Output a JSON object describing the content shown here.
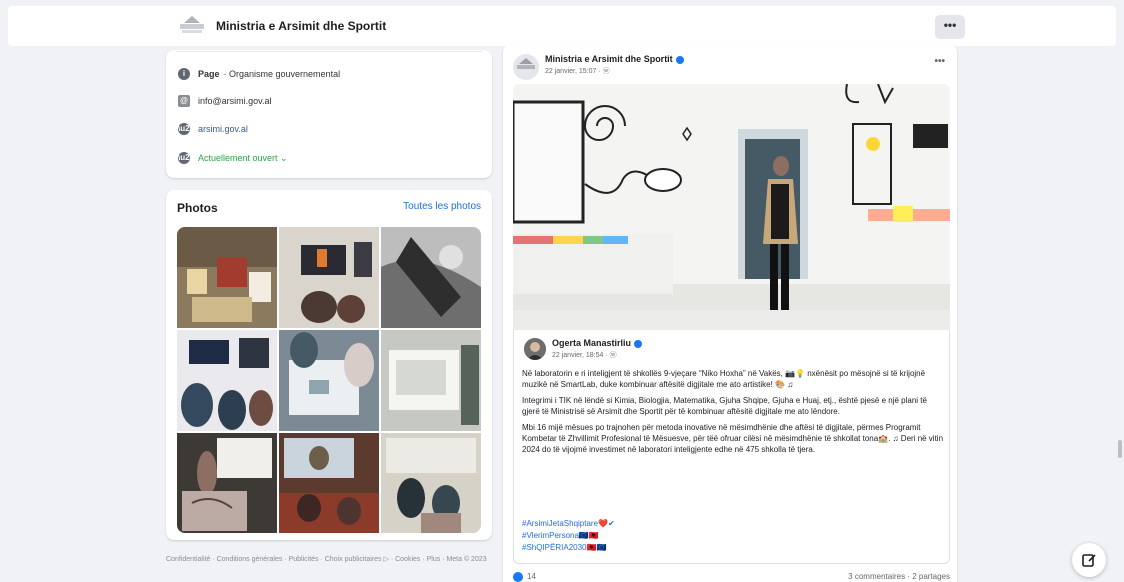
{
  "header": {
    "page_name": "Ministria e Arsimit dhe Sportit",
    "more_label": "•••"
  },
  "intro": {
    "page_label": "Page",
    "page_type": "· Organisme gouvernemental",
    "email": "info@arsimi.gov.al",
    "website": "arsimi.gov.al",
    "hours": "Actuellement ouvert ⌄"
  },
  "photos": {
    "title": "Photos",
    "see_all": "Toutes les photos",
    "items": [
      "photo-1",
      "photo-2",
      "photo-3",
      "photo-4",
      "photo-5",
      "photo-6",
      "photo-7",
      "photo-8",
      "photo-9"
    ]
  },
  "footer": {
    "text": "Confidentialité · Conditions générales · Publicités · Choix publicitaires ▷ · Cookies · Plus · Meta © 2023"
  },
  "post": {
    "author": "Ministria e Arsimit dhe Sportit",
    "meta": "22 janvier, 15:07 · ⓦ",
    "more": "•••",
    "shared": {
      "author": "Ogerta Manastirliu",
      "meta": "22 janvier, 18:54 · ⓦ",
      "paragraphs": [
        "Në laboratorin e ri inteligjent të shkollës 9-vjeçare “Niko Hoxha” në Vakës, 📷💡 nxënësit po mësojnë si të krijojnë muzikë në SmartLab, duke kombinuar aftësitë digjitale me ato artistike! 🎨 ♫",
        "Integrimi i TIK në lëndë si Kimia, Biologjia, Matematika, Gjuha Shqipe, Gjuha e Huaj, etj., është pjesë e një plani të gjerë të Ministrisë së Arsimit dhe Sportit për të kombinuar aftësitë digjitale me ato lëndore.",
        "Mbi 16 mijë mësues po trajnohen për metoda inovative në mësimdhënie dhe aftësi të digjitale, përmes Programit Kombetar të Zhvillimit Profesional të Mësuesve, për tëë ofruar cilësi në mësimdhënie të shkollat tona🏫. ♫ Deri në vitin 2024 do të vijojmë investimet në laboratori inteligjente edhe në 475 shkolla të tjera."
      ],
      "tags": [
        "#ArsimiJetaShqiptare❤️✔",
        "#VlerimPersona🇪🇺🇦🇱",
        "#ShQIPËRIA2030🇦🇱🇪🇺"
      ]
    },
    "likes": "14",
    "counts": "3 commentaires · 2 partages"
  },
  "colors": {
    "background": "#f0f2f5",
    "link": "#216fdb",
    "verified": "#1877f2",
    "open_status": "#31a24c"
  }
}
